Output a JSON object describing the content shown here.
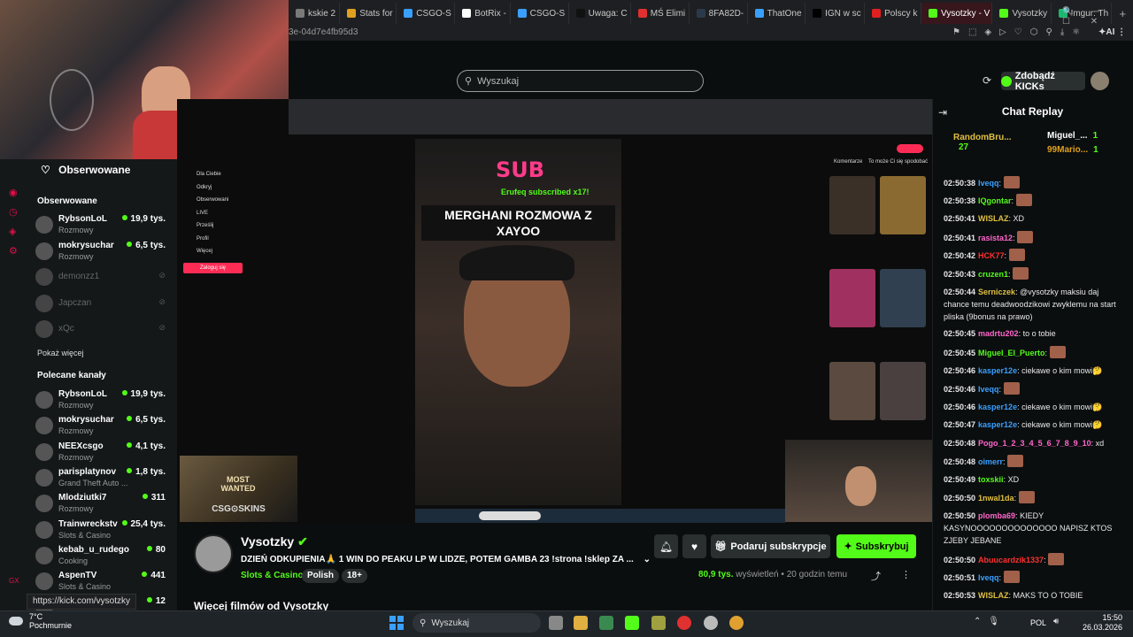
{
  "browser": {
    "tabs": [
      {
        "label": "kskie 2",
        "color": "#7a7a7a"
      },
      {
        "label": "Stats for",
        "color": "#e0a020"
      },
      {
        "label": "CSGO-S",
        "color": "#3aa0ff"
      },
      {
        "label": "BotRix -",
        "color": "#ffffff"
      },
      {
        "label": "CSGO-S",
        "color": "#3aa0ff"
      },
      {
        "label": "Uwaga: C",
        "color": "#111111"
      },
      {
        "label": "MŚ Elimi",
        "color": "#e03030"
      },
      {
        "label": "8FA82D-",
        "color": "#2a3a4a"
      },
      {
        "label": "ThatOne",
        "color": "#3aa0ff"
      },
      {
        "label": "IGN w sc",
        "color": "#000000"
      },
      {
        "label": "Polscy k",
        "color": "#e02020"
      },
      {
        "label": "Vysotzky - V",
        "color": "#53fc18",
        "active": true
      },
      {
        "label": "Vysotzky",
        "color": "#53fc18"
      },
      {
        "label": "Imgur: Th",
        "color": "#1bb76e"
      }
    ],
    "address_fragment": "3e-04d7e4fb95d3",
    "status_url": "https://kick.com/vysotzky"
  },
  "header": {
    "search_placeholder": "Wyszukaj",
    "get_kicks": "Zdobądź KICKs"
  },
  "sidebar": {
    "followed_title": "Obserwowane",
    "followed_heading": "Obserwowane",
    "followed": [
      {
        "name": "RybsonLoL",
        "category": "Rozmowy",
        "viewers": "19,9 tys.",
        "online": true
      },
      {
        "name": "mokrysuchar",
        "category": "Rozmowy",
        "viewers": "6,5 tys.",
        "online": true
      },
      {
        "name": "demonzz1",
        "online": false
      },
      {
        "name": "Japczan",
        "online": false
      },
      {
        "name": "xQc",
        "online": false
      }
    ],
    "show_more": "Pokaż więcej",
    "recommended_heading": "Polecane kanały",
    "recommended": [
      {
        "name": "RybsonLoL",
        "category": "Rozmowy",
        "viewers": "19,9 tys."
      },
      {
        "name": "mokrysuchar",
        "category": "Rozmowy",
        "viewers": "6,5 tys."
      },
      {
        "name": "NEEXcsgo",
        "category": "Rozmowy",
        "viewers": "4,1 tys."
      },
      {
        "name": "parisplatynov",
        "category": "Grand Theft Auto ...",
        "viewers": "1,8 tys."
      },
      {
        "name": "Mlodziutki7",
        "category": "Rozmowy",
        "viewers": "311"
      },
      {
        "name": "Trainwreckstv",
        "category": "Slots & Casino",
        "viewers": "25,4 tys."
      },
      {
        "name": "kebab_u_rudego",
        "category": "Cooking",
        "viewers": "80"
      },
      {
        "name": "AspenTV",
        "category": "Slots & Casino",
        "viewers": "441"
      },
      {
        "name": "",
        "category": "",
        "viewers": "12"
      }
    ]
  },
  "video": {
    "sub_banner": "SUB",
    "sub_text": "Erufeq subscribed x17!",
    "overlay_title": "MERGHANI ROZMOWA Z XAYOO",
    "tiktok_menu": [
      "Dla Ciebie",
      "Odkryj",
      "Obserwowani",
      "LIVE",
      "Prześlij",
      "Profil",
      "Więcej"
    ],
    "tiktok_login": "Zaloguj się",
    "tiktok_tabs": [
      "Komentarze",
      "To może Ci się spodobać"
    ],
    "ad_text": "CSG⊙SKINS",
    "ad_banner": "MOST WANTED"
  },
  "channel": {
    "name": "Vysotzky",
    "title": "DZIEŃ ODKUPIENIA🙏 1 WIN DO PEAKU LP W LIDZE, POTEM GAMBA 23 !strona !sklep ZA ...",
    "category": "Slots & Casino",
    "tags": [
      "Polish",
      "18+"
    ],
    "gift_label": "Podaruj subskrypcje",
    "subscribe_label": "Subskrybuj",
    "views": "80,9 tys.",
    "views_label": "wyświetleń",
    "time_ago": "20 godzin temu",
    "more_videos": "Więcej filmów od Vysotzky"
  },
  "chat": {
    "title": "Chat Replay",
    "pinned": [
      {
        "name": "RandomBru...",
        "count": "27",
        "color": "#e0c040"
      },
      {
        "name": "Miguel_...",
        "count": "1",
        "color": "#ffffff"
      },
      {
        "name": "99Mario...",
        "count": "1",
        "color": "#e0a020"
      }
    ],
    "messages": [
      {
        "time": "02:50:38",
        "user": "Iveqq",
        "color": "#3aa0ff",
        "text": "",
        "emote": true
      },
      {
        "time": "02:50:38",
        "user": "IQgontar",
        "color": "#53fc18",
        "text": "",
        "emote": true
      },
      {
        "time": "02:50:41",
        "user": "WISLAZ",
        "color": "#e0c040",
        "text": "XD"
      },
      {
        "time": "02:50:41",
        "user": "rasista12",
        "color": "#ff66cc",
        "text": "",
        "emote": true
      },
      {
        "time": "02:50:42",
        "user": "HCK77",
        "color": "#ff3030",
        "text": "",
        "emote": true
      },
      {
        "time": "02:50:43",
        "user": "cruzen1",
        "color": "#53fc18",
        "text": "",
        "emote": true
      },
      {
        "time": "02:50:44",
        "user": "Serniczek",
        "color": "#e0c040",
        "text": "@vysotzky maksiu daj chance temu deadwoodzikowi zwyklemu na start pliska (9bonus na prawo)"
      },
      {
        "time": "02:50:45",
        "user": "madrtu202",
        "color": "#ff66cc",
        "text": "to o tobie"
      },
      {
        "time": "02:50:45",
        "user": "Miguel_El_Puerto",
        "color": "#53fc18",
        "text": "",
        "emote": true
      },
      {
        "time": "02:50:46",
        "user": "kasper12e",
        "color": "#3aa0ff",
        "text": "ciekawe o kim mowi🤔"
      },
      {
        "time": "02:50:46",
        "user": "Iveqq",
        "color": "#3aa0ff",
        "text": "",
        "emote": true
      },
      {
        "time": "02:50:46",
        "user": "kasper12e",
        "color": "#3aa0ff",
        "text": "ciekawe o kim mowi🤔"
      },
      {
        "time": "02:50:47",
        "user": "kasper12e",
        "color": "#3aa0ff",
        "text": "ciekawe o kim mowi🤔"
      },
      {
        "time": "02:50:48",
        "user": "Pogo_1_2_3_4_5_6_7_8_9_10",
        "color": "#ff66cc",
        "text": "xd"
      },
      {
        "time": "02:50:48",
        "user": "oimerr",
        "color": "#3aa0ff",
        "text": "",
        "emote": true
      },
      {
        "time": "02:50:49",
        "user": "toxskii",
        "color": "#53fc18",
        "text": "XD"
      },
      {
        "time": "02:50:50",
        "user": "1nwal1da",
        "color": "#e0c040",
        "text": "",
        "emote": true
      },
      {
        "time": "02:50:50",
        "user": "plomba69",
        "color": "#ff66cc",
        "text": "KIEDY KASYNOOOOOOOOOOOOOO NAPISZ KTOS ZJEBY JEBANE"
      },
      {
        "time": "02:50:50",
        "user": "Abuucardzik1337",
        "color": "#ff3030",
        "text": "",
        "emote": true
      },
      {
        "time": "02:50:51",
        "user": "Iveqq",
        "color": "#3aa0ff",
        "text": "",
        "emote": true
      },
      {
        "time": "02:50:53",
        "user": "WISLAZ",
        "color": "#e0c040",
        "text": "MAKS TO O TOBIE"
      }
    ]
  },
  "taskbar": {
    "temp": "7°C",
    "weather": "Pochmurnie",
    "search": "Wyszukaj",
    "lang": "POL",
    "time": "15:50",
    "date": "26.03.2026"
  }
}
